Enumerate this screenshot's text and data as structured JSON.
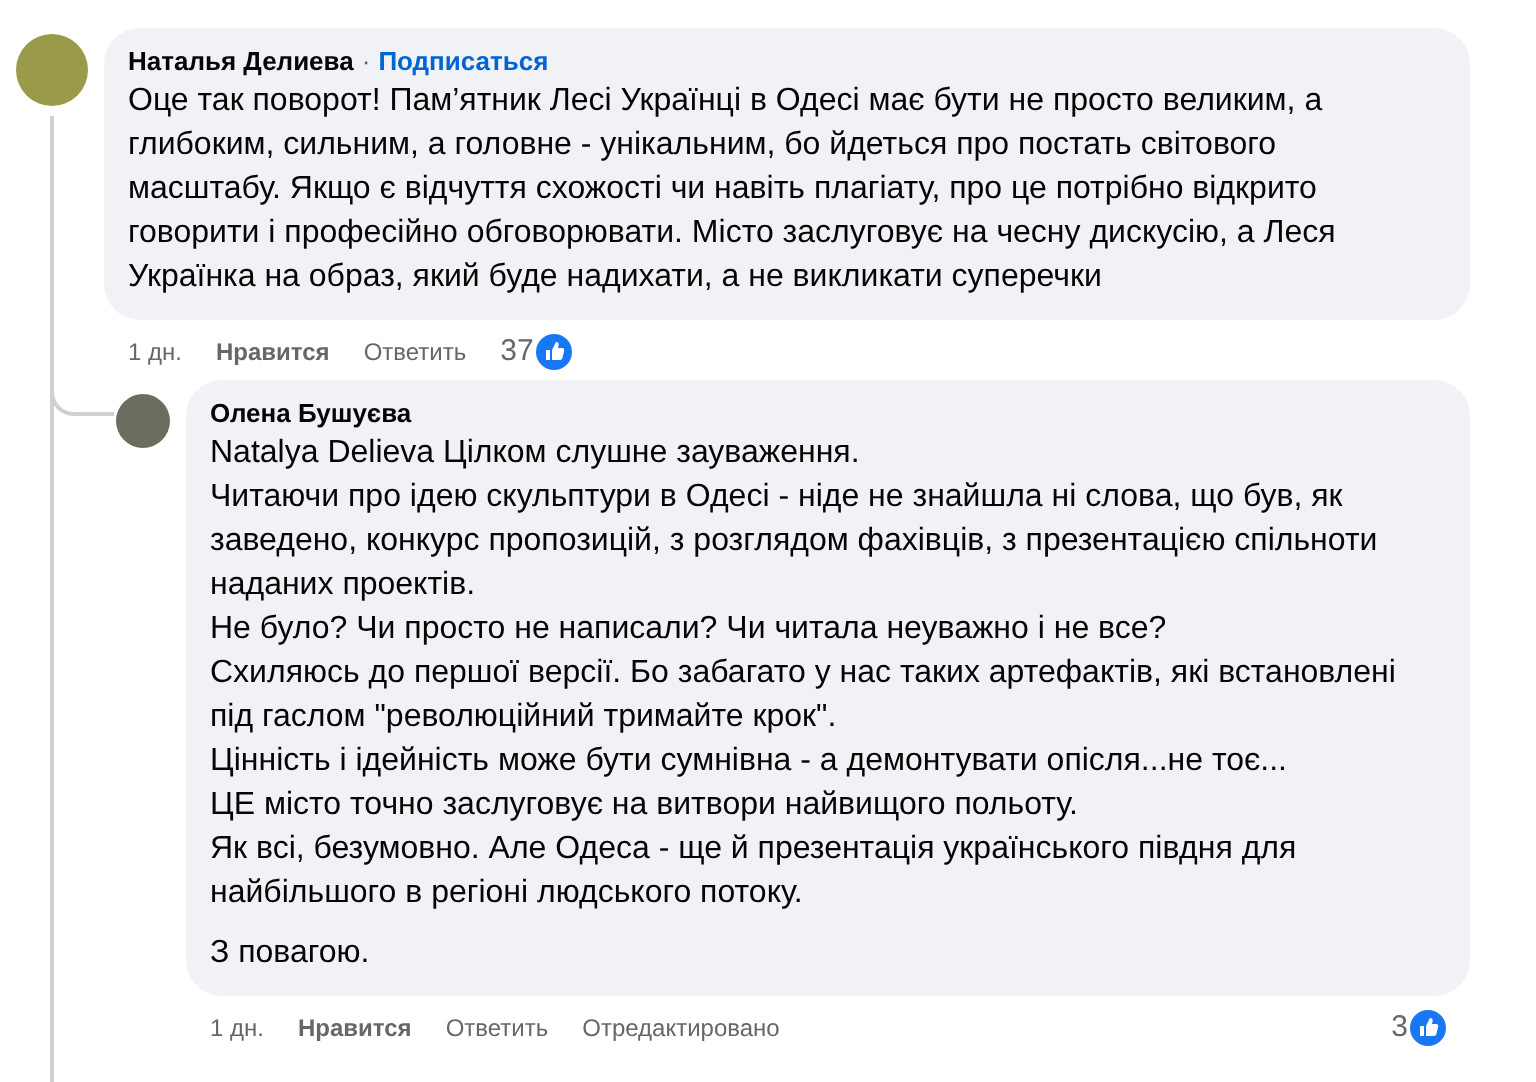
{
  "comments": [
    {
      "author": "Наталья Делиева",
      "separator": "·",
      "follow_link": "Подписаться",
      "paragraphs": [
        "Оце так поворот! Пам’ятник Лесі Українці в Одесі має бути не просто великим, а глибоким, сильним, а головне - унікальним, бо йдеться про постать світового масштабу. Якщо є відчуття схожості чи навіть плагіату, про це потрібно відкрито говорити і професійно обговорювати. Місто заслуговує на чесну дискусію, а Леся Українка на образ, який буде надихати, а не викликати суперечки"
      ],
      "time": "1 дн.",
      "like": "Нравится",
      "reply": "Ответить",
      "reactions": "37",
      "is_reply": false
    },
    {
      "author": "Олена Бушуєва",
      "paragraphs": [
        "Natalya Delieva Цілком слушне зауваження.",
        "Читаючи про ідею скульптури в Одесі - ніде не знайшла ні слова, що був, як заведено, конкурс пропозицій, з розглядом фахівців, з презентацією спільноти наданих проектів.",
        "Не було? Чи просто не написали? Чи читала неуважно і не все?",
        "Схиляюсь до першої версії. Бо забагато у нас таких артефактів, які встановлені під гаслом \"революційний тримайте крок\".",
        "Цінність і ідейність може бути сумнівна - а демонтувати опісля...не тоє...",
        "ЦЕ місто точно заслуговує на витвори найвищого польоту.",
        "Як всі, безумовно. Але Одеса - ще й презентація українського півдня для найбільшого в регіоні людського потоку."
      ],
      "closing": "З повагою.",
      "time": "1 дн.",
      "like": "Нравится",
      "reply": "Ответить",
      "edited": "Отредактировано",
      "reactions": "3",
      "is_reply": true
    }
  ]
}
